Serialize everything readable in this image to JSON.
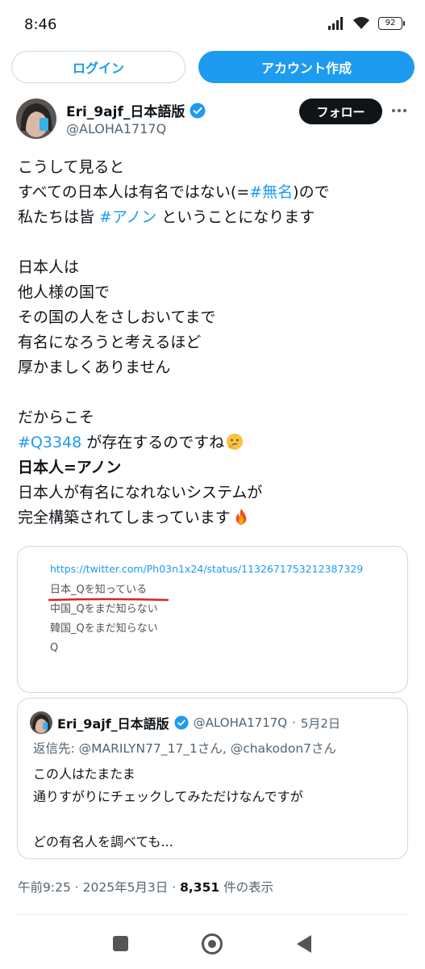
{
  "status_bar": {
    "time": "8:46",
    "battery": "92",
    "icons": [
      "signal-icon",
      "wifi-icon",
      "battery-icon"
    ]
  },
  "auth": {
    "login_label": "ログイン",
    "signup_label": "アカウント作成"
  },
  "author": {
    "name": "Eri_9ajf_日本語版",
    "handle": "@ALOHA1717Q",
    "verified": true,
    "follow_label": "フォロー"
  },
  "tweet": {
    "lines": [
      "こうして見ると",
      "すべての日本人は有名ではない(=",
      "#無名",
      ")ので",
      "私たちは皆 ",
      "#アノン",
      " ということになります",
      "日本人は",
      "他人様の国で",
      "その国の人をさしおいてまで",
      "有名になろうと考えるほど",
      "厚かましくありません",
      "だからこそ",
      "#Q3348",
      " が存在するのですね",
      "日本人=アノン",
      "日本人が有名になれないシステムが",
      "完全構築されてしまっています"
    ]
  },
  "image_card": {
    "url": "https://twitter.com/Ph03n1x24/status/1132671753212387329",
    "list": [
      "日本_Qを知っている",
      "中国_Qをまだ知らない",
      "韓国_Qをまだ知らない",
      "Q"
    ]
  },
  "quote": {
    "name": "Eri_9ajf_日本語版",
    "handle": "@ALOHA1717Q",
    "sep": "·",
    "date": "5月2日",
    "reply_to": "返信先: @MARILYN77_17_1さん, @chakodon7さん",
    "lines": [
      "この人はたまたま",
      "通りすがりにチェックしてみただけなんですが",
      "どの有名人を調べても..."
    ]
  },
  "meta": {
    "time": "午前9:25",
    "sep": "·",
    "date": "2025年5月3日",
    "views_count": "8,351",
    "views_label": " 件の表示"
  },
  "colors": {
    "accent": "#1d9bf0",
    "text": "#0f1419",
    "muted": "#536471",
    "border": "#cfd9de"
  }
}
